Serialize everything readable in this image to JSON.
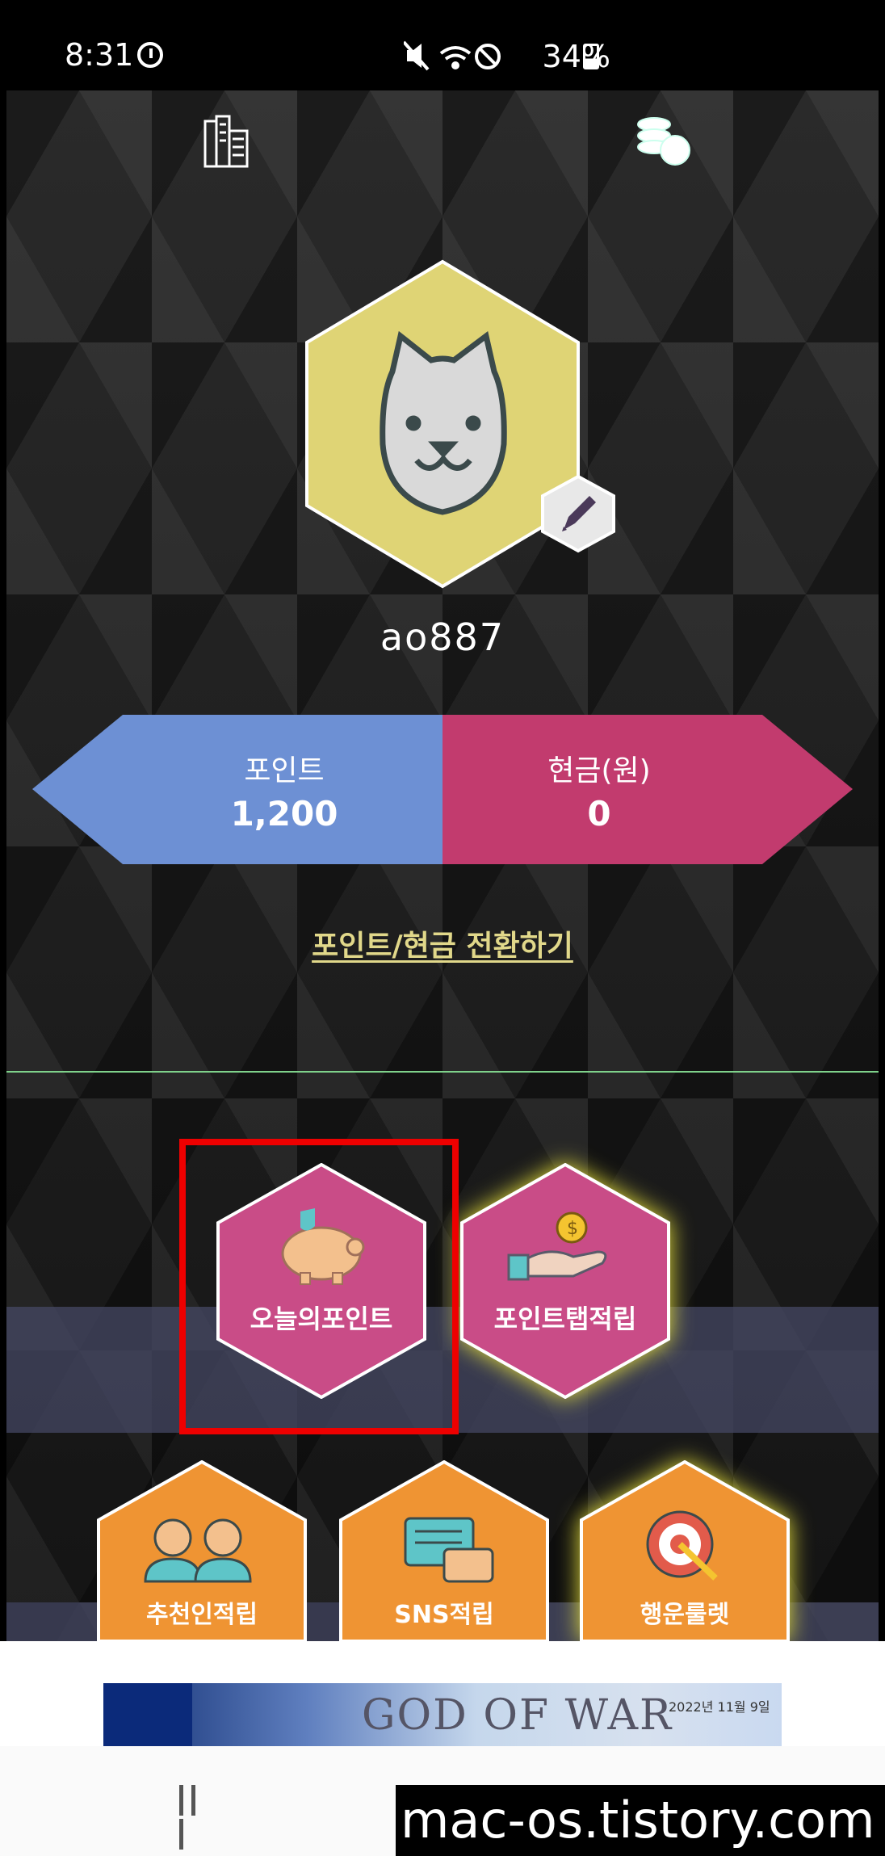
{
  "status_bar": {
    "time": "8:31",
    "battery": "34%"
  },
  "profile": {
    "username": "ao887"
  },
  "balance": {
    "points_label": "포인트",
    "points_value": "1,200",
    "cash_label": "현금(원)",
    "cash_value": "0"
  },
  "convert_link": "포인트/현금 전환하기",
  "tiles": {
    "today_points": "오늘의포인트",
    "point_tap": "포인트탭적립",
    "referral": "추천인적립",
    "sns": "SNS적립",
    "roulette": "행운룰렛"
  },
  "ad": {
    "title": "GOD OF WAR",
    "date": "2022년 11월 9일"
  },
  "watermark": "mac-os.tistory.com",
  "colors": {
    "points_blue": "#6d90d4",
    "cash_pink": "#c23b6e",
    "tile_pink": "#c94c87",
    "tile_orange": "#ef9433",
    "profile_yellow": "#dfd475",
    "highlight_red": "#ee0000"
  }
}
